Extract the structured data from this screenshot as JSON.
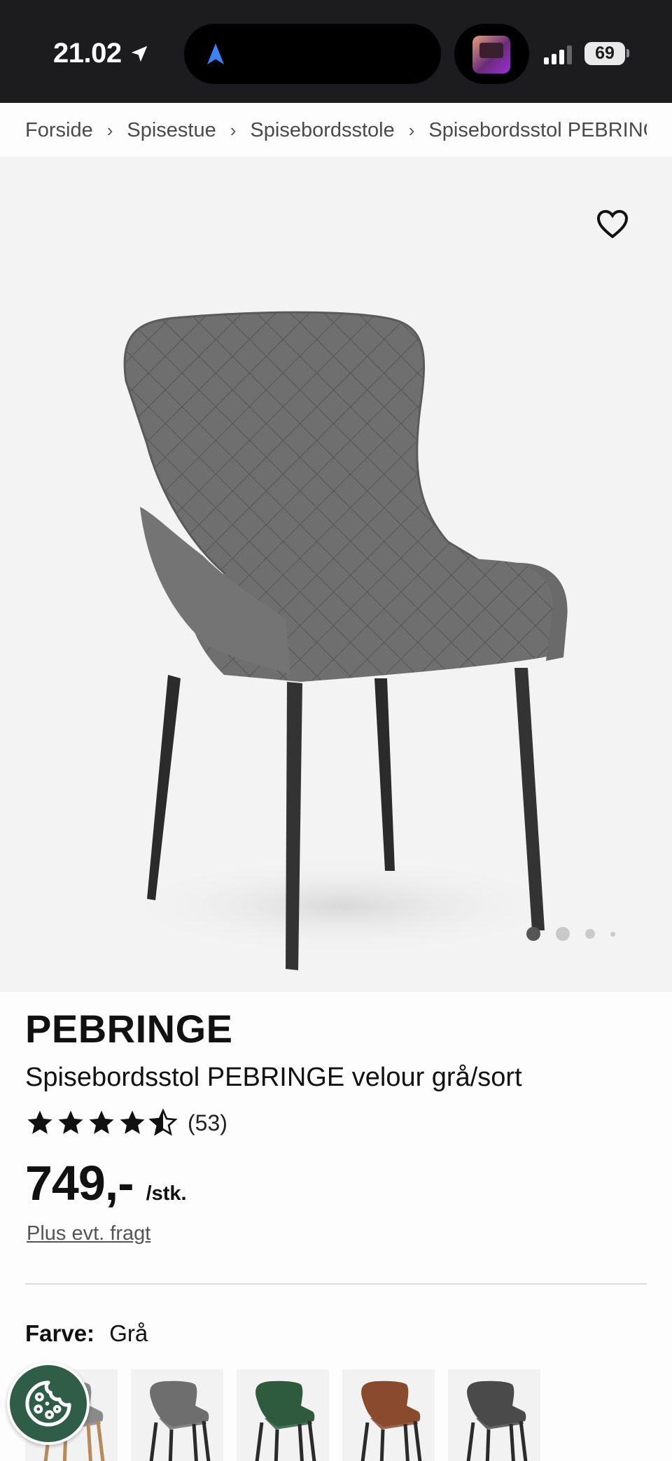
{
  "status_bar": {
    "time": "21.02",
    "battery": "69"
  },
  "breadcrumb": {
    "items": [
      "Forside",
      "Spisestue",
      "Spisebordsstole",
      "Spisebordsstol PEBRINGE"
    ]
  },
  "gallery": {
    "image_count": 4,
    "active_index": 0,
    "chair_color": "#6e6e6e"
  },
  "product": {
    "brand": "PEBRINGE",
    "title": "Spisebordsstol PEBRINGE velour grå/sort",
    "rating": 4.5,
    "review_count": "(53)",
    "price": "749,-",
    "unit": "/stk.",
    "shipping_link": "Plus evt. fragt"
  },
  "color_selector": {
    "label": "Farve:",
    "value": "Grå",
    "swatches": [
      {
        "name": "Grå natur",
        "color": "#8a8a8a",
        "legs": "#b78a5a"
      },
      {
        "name": "Grå",
        "color": "#6e6e6e",
        "legs": "#2b2b2b"
      },
      {
        "name": "Grøn",
        "color": "#2e5a3e",
        "legs": "#2b2b2b"
      },
      {
        "name": "Brun",
        "color": "#8a4a2e",
        "legs": "#2b2b2b"
      },
      {
        "name": "Mørkegrå",
        "color": "#4a4a4a",
        "legs": "#2b2b2b"
      }
    ]
  },
  "accent_color": "#2f5d48"
}
